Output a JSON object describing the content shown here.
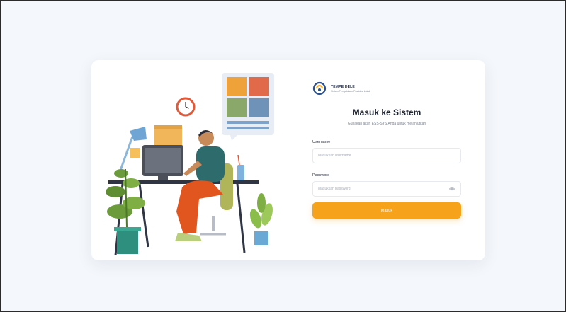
{
  "app": {
    "name": "TEMPE DELE",
    "tagline": "Sistem Pengelolaan Produksi Lokal"
  },
  "login": {
    "title": "Masuk ke Sistem",
    "subtitle": "Gunakan akun ESS-SYS Anda untuk melanjutkan",
    "username_label": "Username",
    "username_placeholder": "Masukkan username",
    "password_label": "Password",
    "password_placeholder": "Masukkan password",
    "submit_label": "Masuk"
  },
  "colors": {
    "accent": "#f7a21b",
    "background": "#f4f7fb",
    "card": "#ffffff"
  },
  "icons": {
    "logo": "brand-logo-icon",
    "password_toggle": "eye-icon"
  }
}
